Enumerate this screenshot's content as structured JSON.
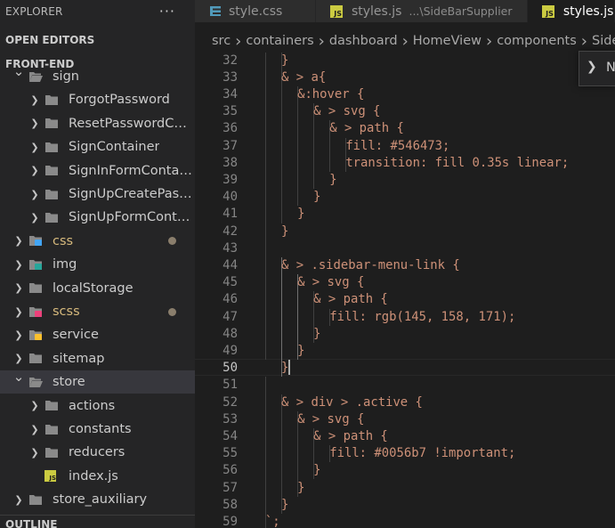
{
  "sidebar": {
    "title": "EXPLORER",
    "more": "···",
    "open_editors": "OPEN EDITORS",
    "project": "FRONT-END",
    "outline": "OUTLINE",
    "tree": [
      {
        "label": "sign",
        "kind": "folder-open",
        "icon": "folder-icon"
      },
      {
        "label": "ForgotPassword",
        "kind": "folder",
        "icon": "folder-icon"
      },
      {
        "label": "ResetPasswordCon...",
        "kind": "folder",
        "icon": "folder-icon"
      },
      {
        "label": "SignContainer",
        "kind": "folder",
        "icon": "folder-icon"
      },
      {
        "label": "SignInFormContai...",
        "kind": "folder",
        "icon": "folder-icon"
      },
      {
        "label": "SignUpCreatePass...",
        "kind": "folder",
        "icon": "folder-icon"
      },
      {
        "label": "SignUpFormContai...",
        "kind": "folder",
        "icon": "folder-icon"
      },
      {
        "label": "css",
        "kind": "folder",
        "icon": "css-folder-icon",
        "label_color": "#d7ba7d",
        "modified": true
      },
      {
        "label": "img",
        "kind": "folder",
        "icon": "image-folder-icon"
      },
      {
        "label": "localStorage",
        "kind": "folder",
        "icon": "folder-icon"
      },
      {
        "label": "scss",
        "kind": "folder",
        "icon": "sass-folder-icon",
        "label_color": "#d7ba7d",
        "modified": true
      },
      {
        "label": "service",
        "kind": "folder",
        "icon": "service-folder-icon"
      },
      {
        "label": "sitemap",
        "kind": "folder",
        "icon": "folder-icon"
      },
      {
        "label": "store",
        "kind": "folder-open",
        "icon": "folder-icon",
        "selected": true
      },
      {
        "label": "actions",
        "kind": "folder",
        "icon": "folder-icon"
      },
      {
        "label": "constants",
        "kind": "folder",
        "icon": "constants-folder-icon"
      },
      {
        "label": "reducers",
        "kind": "folder",
        "icon": "folder-icon"
      },
      {
        "label": "index.js",
        "kind": "file",
        "icon": "js-file-icon"
      },
      {
        "label": "store_auxiliary",
        "kind": "folder",
        "icon": "folder-icon"
      }
    ]
  },
  "tabs": [
    {
      "label": "style.css",
      "description": "",
      "icon": "css-icon",
      "active": false
    },
    {
      "label": "styles.js",
      "description": "...\\SideBarSupplier",
      "icon": "js-icon",
      "active": false
    },
    {
      "label": "styles.js",
      "description": "",
      "icon": "js-icon",
      "active": true
    }
  ],
  "breadcrumb": [
    "src",
    "containers",
    "dashboard",
    "HomeView",
    "components",
    "SideB"
  ],
  "breadcrumb_popup": {
    "text": "N"
  },
  "editor": {
    "current_line": 50,
    "lines": [
      {
        "n": "32",
        "text": "}"
      },
      {
        "n": "33",
        "text": "& > a{"
      },
      {
        "n": "34",
        "text": "&:hover {"
      },
      {
        "n": "35",
        "text": "& > svg {"
      },
      {
        "n": "36",
        "text": "& > path {"
      },
      {
        "n": "37",
        "text": "fill: #546473;"
      },
      {
        "n": "38",
        "text": "transition: fill 0.35s linear;"
      },
      {
        "n": "39",
        "text": "}"
      },
      {
        "n": "40",
        "text": "}"
      },
      {
        "n": "41",
        "text": "}"
      },
      {
        "n": "42",
        "text": "}"
      },
      {
        "n": "43",
        "text": ""
      },
      {
        "n": "44",
        "text": "& > .sidebar-menu-link {"
      },
      {
        "n": "45",
        "text": "& > svg {"
      },
      {
        "n": "46",
        "text": "& > path {"
      },
      {
        "n": "47",
        "text": "fill: rgb(145, 158, 171);"
      },
      {
        "n": "48",
        "text": "}"
      },
      {
        "n": "49",
        "text": "}"
      },
      {
        "n": "50",
        "text": "}"
      },
      {
        "n": "51",
        "text": ""
      },
      {
        "n": "52",
        "text": "& > div > .active {"
      },
      {
        "n": "53",
        "text": "& > svg {"
      },
      {
        "n": "54",
        "text": "& > path {"
      },
      {
        "n": "55",
        "text": "fill: #0056b7 !important;"
      },
      {
        "n": "56",
        "text": "}"
      },
      {
        "n": "57",
        "text": "}"
      },
      {
        "n": "58",
        "text": "}"
      },
      {
        "n": "59",
        "text": "`;"
      }
    ]
  },
  "colors": {
    "code_string": "#ce9178",
    "line_number": "#858585",
    "modified_dot": "#8a7e6c"
  }
}
